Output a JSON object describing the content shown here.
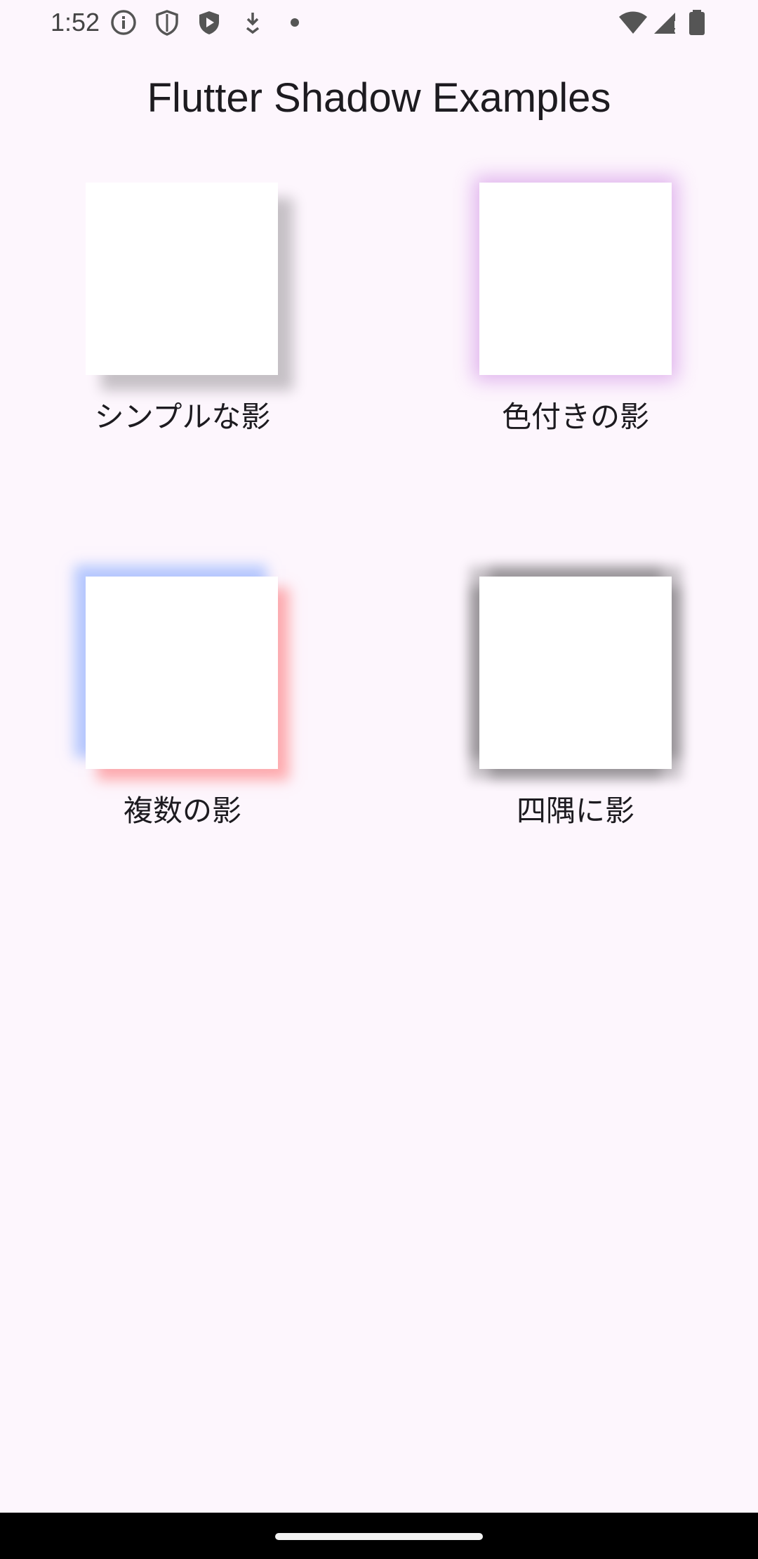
{
  "status_bar": {
    "time": "1:52",
    "icons": [
      "info-icon",
      "shield-outline-icon",
      "shield-play-icon",
      "download-icon",
      "dot-icon",
      "wifi-icon",
      "signal-icon",
      "battery-icon"
    ]
  },
  "app": {
    "title": "Flutter Shadow Examples"
  },
  "examples": [
    {
      "label": "シンプルな影",
      "shadow": "simple",
      "shadow_colors": [
        "#000000"
      ]
    },
    {
      "label": "色付きの影",
      "shadow": "colored",
      "shadow_colors": [
        "#be64dc"
      ]
    },
    {
      "label": "複数の影",
      "shadow": "multiple",
      "shadow_colors": [
        "#78a0ff",
        "#ff6e6e"
      ]
    },
    {
      "label": "四隅に影",
      "shadow": "corners",
      "shadow_colors": [
        "#000000"
      ]
    }
  ],
  "colors": {
    "background": "#fdf6fd",
    "box": "#ffffff",
    "nav_bar": "#000000"
  }
}
